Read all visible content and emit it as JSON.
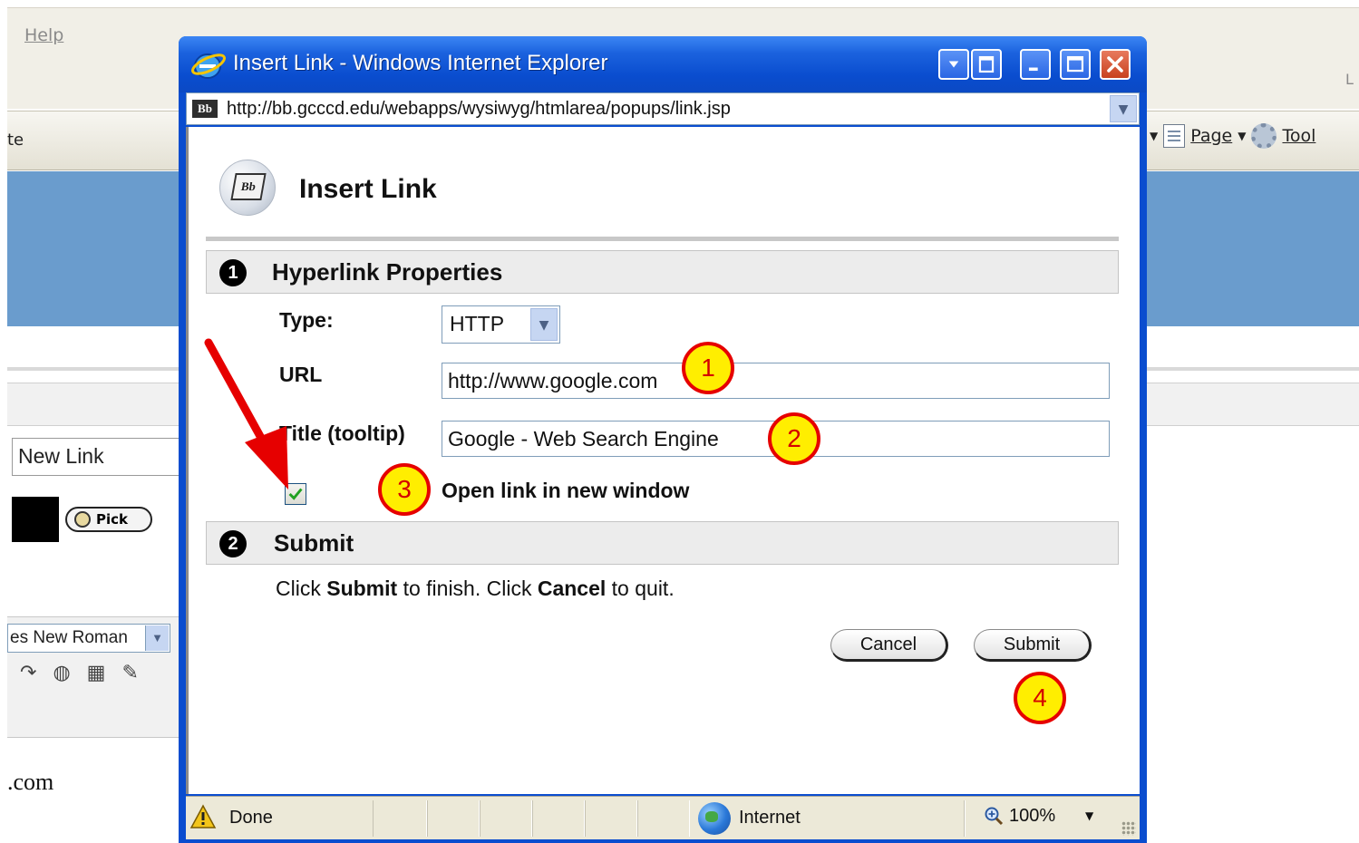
{
  "background_app": {
    "menu_help": "Help",
    "menu_partial": "L",
    "tab_partial": "te",
    "toolbar": {
      "page_label": "Page",
      "tools_label": "Tool"
    },
    "link_text_value": "New Link",
    "pick_button": "Pick",
    "font_select_value": "es New Roman",
    "content_partial": ".com"
  },
  "popup": {
    "window_title": "Insert Link - Windows Internet Explorer",
    "address_url": "http://bb.gcccd.edu/webapps/wysiwyg/htmlarea/popups/link.jsp",
    "page_title": "Insert Link",
    "bb_icon_text": "Bb",
    "step1": {
      "number": "1",
      "title": "Hyperlink Properties"
    },
    "fields": {
      "type_label": "Type:",
      "type_value": "HTTP",
      "url_label": "URL",
      "url_value": "http://www.google.com",
      "title_label": "Title (tooltip)",
      "title_value": "Google - Web Search Engine",
      "new_window_label": "Open link in new window",
      "new_window_checked": true
    },
    "step2": {
      "number": "2",
      "title": "Submit"
    },
    "instructions": {
      "part1": "Click ",
      "bold1": "Submit",
      "part2": " to finish. Click ",
      "bold2": "Cancel",
      "part3": " to quit."
    },
    "buttons": {
      "cancel": "Cancel",
      "submit": "Submit"
    },
    "statusbar": {
      "status": "Done",
      "zone": "Internet",
      "zoom": "100%"
    }
  },
  "annotations": {
    "badge_1": "1",
    "badge_2": "2",
    "badge_3": "3",
    "badge_4": "4"
  },
  "colors": {
    "title_bar": "#0a4dcf",
    "badge_fill": "#ffee00",
    "badge_border": "#e60000",
    "arrow": "#e60000",
    "background_band": "#6a9ccd"
  }
}
